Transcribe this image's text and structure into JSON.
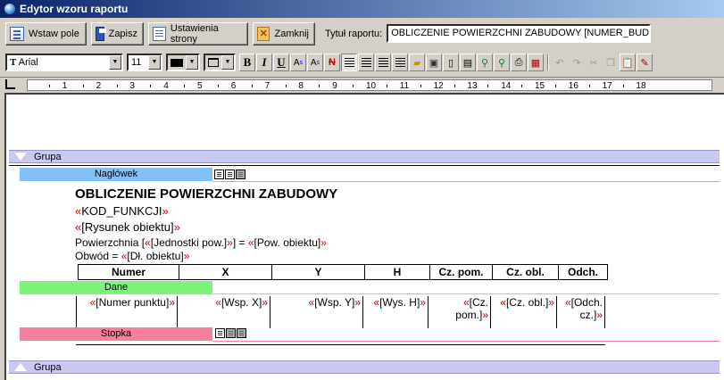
{
  "window": {
    "title": "Edytor wzoru raportu"
  },
  "toolbar": {
    "insert_field": "Wstaw pole",
    "save": "Zapisz",
    "page_settings": "Ustawienia strony",
    "close": "Zamknij",
    "report_title_label": "Tytuł raportu:",
    "report_title_value": "OBLICZENIE POWIERZCHNI ZABUDOWY [NUMER_BUD]"
  },
  "format": {
    "font_name": "Arial",
    "font_size": "11",
    "bold": "B",
    "italic": "I",
    "underline": "U"
  },
  "ruler": {
    "marks": [
      "1",
      "2",
      "3",
      "4",
      "5",
      "6",
      "7",
      "8",
      "9",
      "10",
      "11",
      "12",
      "13",
      "14",
      "15",
      "16",
      "17",
      "18"
    ]
  },
  "report": {
    "group_top_label": "Grupa",
    "group_bottom_label": "Grupa",
    "header_tab": "Nagłówek",
    "data_tab": "Dane",
    "footer_tab": "Stopka",
    "title": "OBLICZENIE POWIERZCHNI ZABUDOWY",
    "field_function": "KOD_FUNKCJI",
    "field_drawing": "[Rysunek obiektu]",
    "area_prefix": "Powierzchnia [",
    "area_unit_field": "[Jednostki pow.]",
    "area_mid": "] = ",
    "area_value_field": "[Pow. obiektu]",
    "perimeter_prefix": "Obwód = ",
    "perimeter_field": "[Dł. obiektu]",
    "columns": [
      "Numer",
      "X",
      "Y",
      "H",
      "Cz. pom.",
      "Cz. obl.",
      "Odch."
    ],
    "data_fields": [
      "[Numer punktu]",
      "[Wsp. X]",
      "[Wsp. Y]",
      "[Wys. H]",
      "[Cz. pom.]",
      "[Cz. obl.]",
      "[Odch. cz.]"
    ]
  },
  "colors": {
    "header_tab": "#84c0f8",
    "data_tab": "#7cf47c",
    "footer_tab": "#f8809c",
    "group_band": "#c8c8f0"
  }
}
